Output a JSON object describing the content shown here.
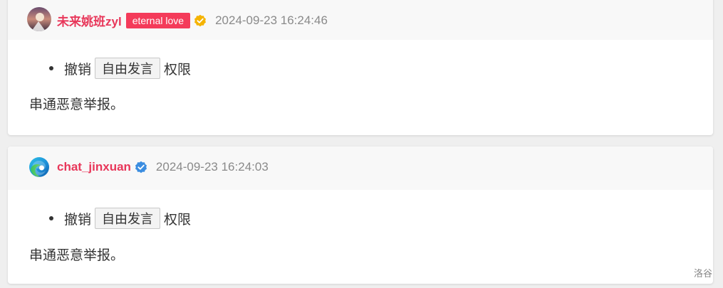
{
  "posts": [
    {
      "username": "未来姚班zyl",
      "badge": "eternal love",
      "verify_color": "#f5b300",
      "timestamp": "2024-09-23 16:24:46",
      "action": "撤销",
      "permission": "自由发言",
      "suffix": "权限",
      "reason": "串通恶意举报。"
    },
    {
      "username": "chat_jinxuan",
      "verify_color": "#3b8de0",
      "timestamp": "2024-09-23 16:24:03",
      "action": "撤销",
      "permission": "自由发言",
      "suffix": "权限",
      "reason": "串通恶意举报。"
    }
  ],
  "watermark": "洛谷",
  "colors": {
    "username": "#e8375a",
    "badge_bg": "#f43b5a",
    "header_bg": "#f8f8f8",
    "page_bg": "#efefef"
  }
}
